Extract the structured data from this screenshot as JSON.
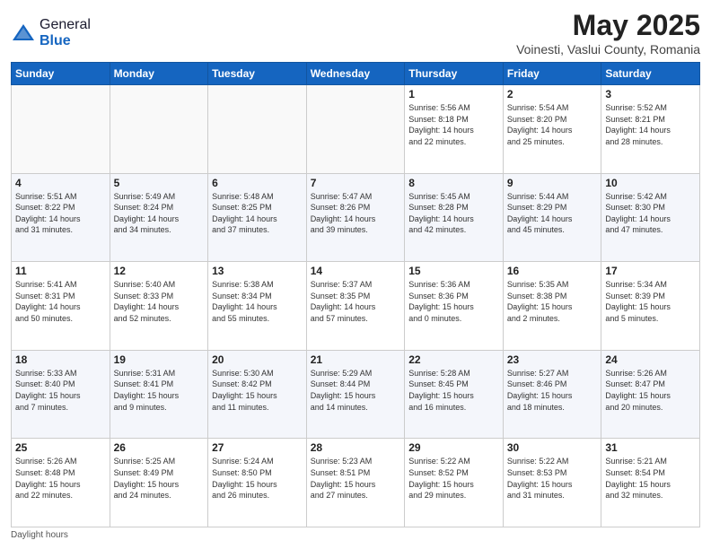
{
  "logo": {
    "general": "General",
    "blue": "Blue"
  },
  "header": {
    "month": "May 2025",
    "location": "Voinesti, Vaslui County, Romania"
  },
  "weekdays": [
    "Sunday",
    "Monday",
    "Tuesday",
    "Wednesday",
    "Thursday",
    "Friday",
    "Saturday"
  ],
  "footer": {
    "note": "Daylight hours"
  },
  "weeks": [
    [
      {
        "day": "",
        "info": ""
      },
      {
        "day": "",
        "info": ""
      },
      {
        "day": "",
        "info": ""
      },
      {
        "day": "",
        "info": ""
      },
      {
        "day": "1",
        "info": "Sunrise: 5:56 AM\nSunset: 8:18 PM\nDaylight: 14 hours\nand 22 minutes."
      },
      {
        "day": "2",
        "info": "Sunrise: 5:54 AM\nSunset: 8:20 PM\nDaylight: 14 hours\nand 25 minutes."
      },
      {
        "day": "3",
        "info": "Sunrise: 5:52 AM\nSunset: 8:21 PM\nDaylight: 14 hours\nand 28 minutes."
      }
    ],
    [
      {
        "day": "4",
        "info": "Sunrise: 5:51 AM\nSunset: 8:22 PM\nDaylight: 14 hours\nand 31 minutes."
      },
      {
        "day": "5",
        "info": "Sunrise: 5:49 AM\nSunset: 8:24 PM\nDaylight: 14 hours\nand 34 minutes."
      },
      {
        "day": "6",
        "info": "Sunrise: 5:48 AM\nSunset: 8:25 PM\nDaylight: 14 hours\nand 37 minutes."
      },
      {
        "day": "7",
        "info": "Sunrise: 5:47 AM\nSunset: 8:26 PM\nDaylight: 14 hours\nand 39 minutes."
      },
      {
        "day": "8",
        "info": "Sunrise: 5:45 AM\nSunset: 8:28 PM\nDaylight: 14 hours\nand 42 minutes."
      },
      {
        "day": "9",
        "info": "Sunrise: 5:44 AM\nSunset: 8:29 PM\nDaylight: 14 hours\nand 45 minutes."
      },
      {
        "day": "10",
        "info": "Sunrise: 5:42 AM\nSunset: 8:30 PM\nDaylight: 14 hours\nand 47 minutes."
      }
    ],
    [
      {
        "day": "11",
        "info": "Sunrise: 5:41 AM\nSunset: 8:31 PM\nDaylight: 14 hours\nand 50 minutes."
      },
      {
        "day": "12",
        "info": "Sunrise: 5:40 AM\nSunset: 8:33 PM\nDaylight: 14 hours\nand 52 minutes."
      },
      {
        "day": "13",
        "info": "Sunrise: 5:38 AM\nSunset: 8:34 PM\nDaylight: 14 hours\nand 55 minutes."
      },
      {
        "day": "14",
        "info": "Sunrise: 5:37 AM\nSunset: 8:35 PM\nDaylight: 14 hours\nand 57 minutes."
      },
      {
        "day": "15",
        "info": "Sunrise: 5:36 AM\nSunset: 8:36 PM\nDaylight: 15 hours\nand 0 minutes."
      },
      {
        "day": "16",
        "info": "Sunrise: 5:35 AM\nSunset: 8:38 PM\nDaylight: 15 hours\nand 2 minutes."
      },
      {
        "day": "17",
        "info": "Sunrise: 5:34 AM\nSunset: 8:39 PM\nDaylight: 15 hours\nand 5 minutes."
      }
    ],
    [
      {
        "day": "18",
        "info": "Sunrise: 5:33 AM\nSunset: 8:40 PM\nDaylight: 15 hours\nand 7 minutes."
      },
      {
        "day": "19",
        "info": "Sunrise: 5:31 AM\nSunset: 8:41 PM\nDaylight: 15 hours\nand 9 minutes."
      },
      {
        "day": "20",
        "info": "Sunrise: 5:30 AM\nSunset: 8:42 PM\nDaylight: 15 hours\nand 11 minutes."
      },
      {
        "day": "21",
        "info": "Sunrise: 5:29 AM\nSunset: 8:44 PM\nDaylight: 15 hours\nand 14 minutes."
      },
      {
        "day": "22",
        "info": "Sunrise: 5:28 AM\nSunset: 8:45 PM\nDaylight: 15 hours\nand 16 minutes."
      },
      {
        "day": "23",
        "info": "Sunrise: 5:27 AM\nSunset: 8:46 PM\nDaylight: 15 hours\nand 18 minutes."
      },
      {
        "day": "24",
        "info": "Sunrise: 5:26 AM\nSunset: 8:47 PM\nDaylight: 15 hours\nand 20 minutes."
      }
    ],
    [
      {
        "day": "25",
        "info": "Sunrise: 5:26 AM\nSunset: 8:48 PM\nDaylight: 15 hours\nand 22 minutes."
      },
      {
        "day": "26",
        "info": "Sunrise: 5:25 AM\nSunset: 8:49 PM\nDaylight: 15 hours\nand 24 minutes."
      },
      {
        "day": "27",
        "info": "Sunrise: 5:24 AM\nSunset: 8:50 PM\nDaylight: 15 hours\nand 26 minutes."
      },
      {
        "day": "28",
        "info": "Sunrise: 5:23 AM\nSunset: 8:51 PM\nDaylight: 15 hours\nand 27 minutes."
      },
      {
        "day": "29",
        "info": "Sunrise: 5:22 AM\nSunset: 8:52 PM\nDaylight: 15 hours\nand 29 minutes."
      },
      {
        "day": "30",
        "info": "Sunrise: 5:22 AM\nSunset: 8:53 PM\nDaylight: 15 hours\nand 31 minutes."
      },
      {
        "day": "31",
        "info": "Sunrise: 5:21 AM\nSunset: 8:54 PM\nDaylight: 15 hours\nand 32 minutes."
      }
    ]
  ]
}
